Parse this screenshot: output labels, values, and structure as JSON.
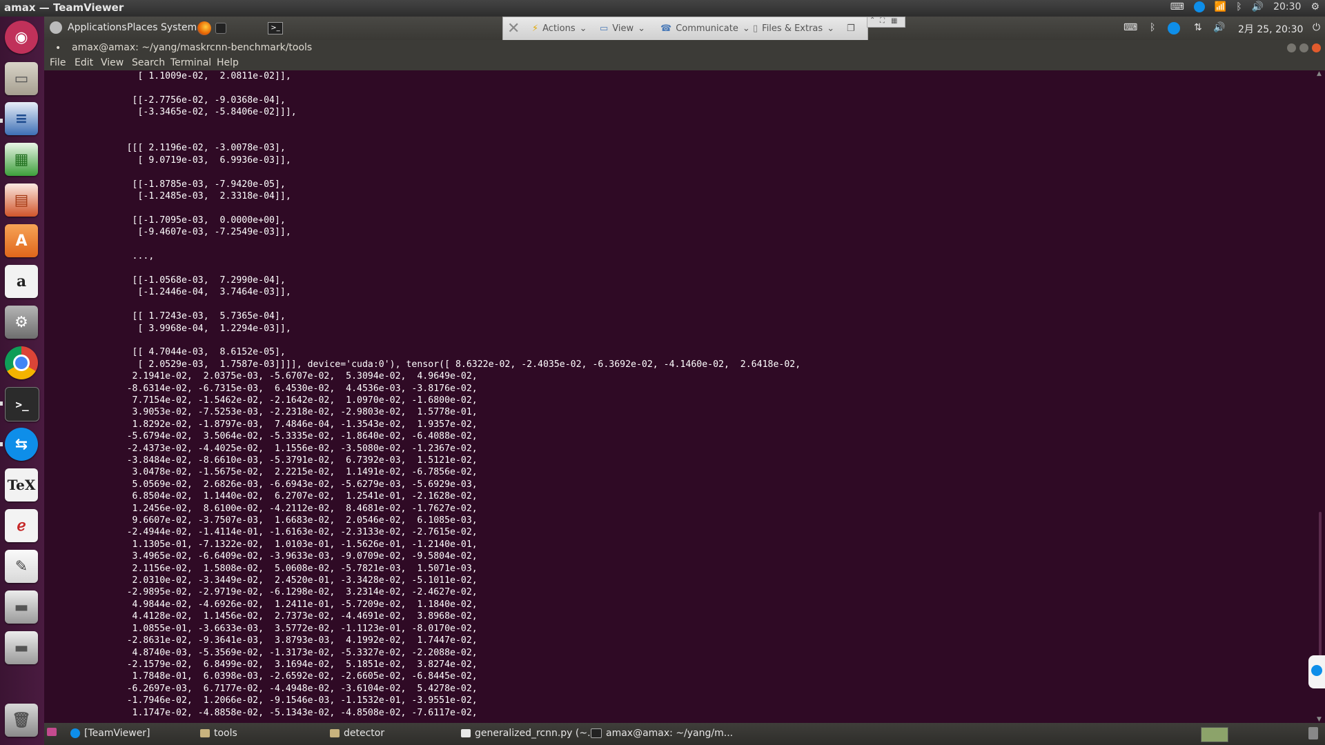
{
  "outer": {
    "title": "amax — TeamViewer",
    "time": "20:30"
  },
  "gnome_panel": {
    "applications": "Applications",
    "places": "Places",
    "system": "System",
    "datetime": "2月 25, 20:30"
  },
  "teamviewer": {
    "actions": "Actions",
    "view": "View",
    "communicate": "Communicate",
    "files_extras": "Files & Extras"
  },
  "terminal": {
    "title": "amax@amax: ~/yang/maskrcnn-benchmark/tools",
    "menu": [
      "File",
      "Edit",
      "View",
      "Search",
      "Terminal",
      "Help"
    ],
    "output": "         [ 1.1009e-02,  2.0811e-02]],\n\n        [[-2.7756e-02, -9.0368e-04],\n         [-3.3465e-02, -5.8406e-02]]],\n\n\n       [[[ 2.1196e-02, -3.0078e-03],\n         [ 9.0719e-03,  6.9936e-03]],\n\n        [[-1.8785e-03, -7.9420e-05],\n         [-1.2485e-03,  2.3318e-04]],\n\n        [[-1.7095e-03,  0.0000e+00],\n         [-9.4607e-03, -7.2549e-03]],\n\n        ...,\n\n        [[-1.0568e-03,  7.2990e-04],\n         [-1.2446e-04,  3.7464e-03]],\n\n        [[ 1.7243e-03,  5.7365e-04],\n         [ 3.9968e-04,  1.2294e-03]],\n\n        [[ 4.7044e-03,  8.6152e-05],\n         [ 2.0529e-03,  1.7587e-03]]]], device='cuda:0'), tensor([ 8.6322e-02, -2.4035e-02, -6.3692e-02, -4.1460e-02,  2.6418e-02,\n        2.1941e-02,  2.0375e-03, -5.6707e-02,  5.3094e-02,  4.9649e-02,\n       -8.6314e-02, -6.7315e-03,  6.4530e-02,  4.4536e-03, -3.8176e-02,\n        7.7154e-02, -1.5462e-02, -2.1642e-02,  1.0970e-02, -1.6800e-02,\n        3.9053e-02, -7.5253e-03, -2.2318e-02, -2.9803e-02,  1.5778e-01,\n        1.8292e-02, -1.8797e-03,  7.4846e-04, -1.3543e-02,  1.9357e-02,\n       -5.6794e-02,  3.5064e-02, -5.3335e-02, -1.8640e-02, -6.4088e-02,\n       -2.4373e-02, -4.4025e-02,  1.1556e-02, -3.5080e-02, -1.2367e-02,\n       -3.8484e-02, -8.6610e-03, -5.3791e-02,  6.7392e-03,  1.5121e-02,\n        3.0478e-02, -1.5675e-02,  2.2215e-02,  1.1491e-02, -6.7856e-02,\n        5.0569e-02,  2.6826e-03, -6.6943e-02, -5.6279e-03, -5.6929e-03,\n        6.8504e-02,  1.1440e-02,  6.2707e-02,  1.2541e-01, -2.1628e-02,\n        1.2456e-02,  8.6100e-02, -4.2112e-02,  8.4681e-02, -1.7627e-02,\n        9.6607e-02, -3.7507e-03,  1.6683e-02,  2.0546e-02,  6.1085e-03,\n       -2.4944e-02, -1.4114e-01, -1.6163e-02, -2.3133e-02, -2.7615e-02,\n        1.1305e-01, -7.1322e-02,  1.0103e-01, -1.5626e-01, -1.2140e-01,\n        3.4965e-02, -6.6409e-02, -3.9633e-03, -9.0709e-02, -9.5804e-02,\n        2.1156e-02,  1.5808e-02,  5.0608e-02, -5.7821e-03,  1.5071e-03,\n        2.0310e-02, -3.3449e-02,  2.4520e-01, -3.3428e-02, -5.1011e-02,\n       -2.9895e-02, -2.9719e-02, -6.1298e-02,  3.2314e-02, -2.4627e-02,\n        4.9844e-02, -4.6926e-02,  1.2411e-01, -5.7209e-02,  1.1840e-02,\n        4.4128e-02,  1.1456e-02,  2.7373e-02, -4.4691e-02,  3.8968e-02,\n        1.0855e-01, -3.6633e-03,  3.5772e-02, -1.1123e-01, -8.0170e-02,\n       -2.8631e-02, -9.3641e-03,  3.8793e-03,  4.1992e-02,  1.7447e-02,\n        4.8740e-03, -5.3569e-02, -1.3173e-02, -5.3327e-02, -2.2088e-02,\n       -2.1579e-02,  6.8499e-02,  3.1694e-02,  5.1851e-02,  3.8274e-02,\n        1.7848e-01,  6.0398e-03, -2.6592e-02, -2.6605e-02, -6.8445e-02,\n       -6.2697e-03,  6.7177e-02, -4.4948e-02, -3.6104e-02,  5.4278e-02,\n       -1.7946e-02,  1.2066e-02, -9.1546e-03, -1.1532e-01, -3.9551e-02,\n        1.1747e-02, -4.8858e-02, -5.1343e-02, -4.8508e-02, -7.6117e-02,"
  },
  "taskbar": {
    "items": [
      "[TeamViewer]",
      "tools",
      "detector",
      "generalized_rcnn.py (~...",
      "amax@amax: ~/yang/m..."
    ]
  },
  "colors": {
    "terminal_bg": "#2f0a25",
    "terminal_fg": "#ffffff",
    "panel": "#3c3b37"
  }
}
